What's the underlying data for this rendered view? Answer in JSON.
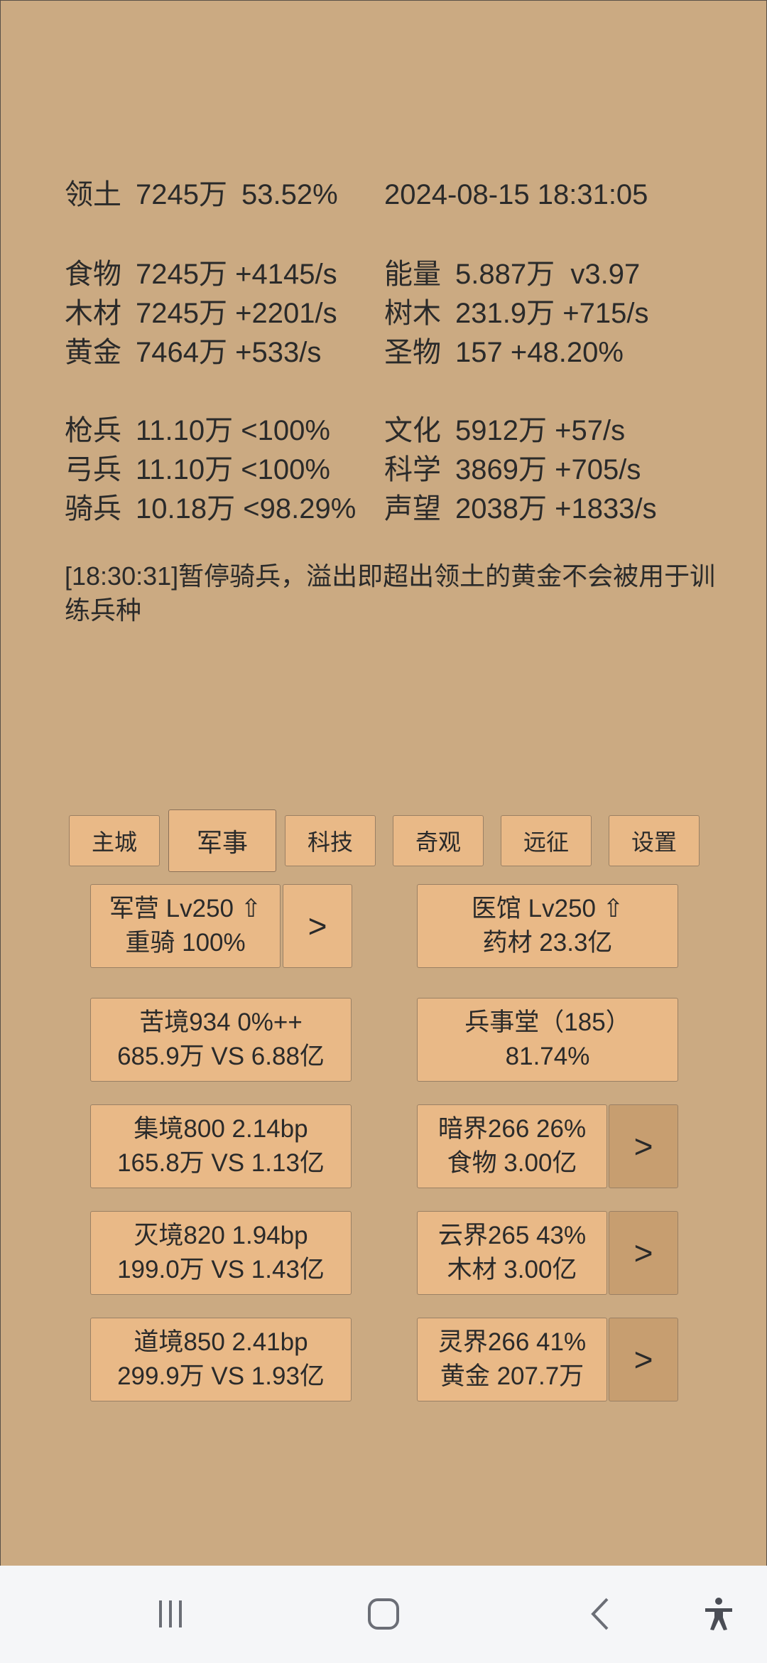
{
  "header": {
    "territory_label": "领土",
    "territory_value": "7245万",
    "territory_pct": "53.52%",
    "datetime": "2024-08-15 18:31:05"
  },
  "resources": [
    {
      "label": "食物",
      "value": "7245万",
      "rate": "+4145/s"
    },
    {
      "label": "木材",
      "value": "7245万",
      "rate": "+2201/s"
    },
    {
      "label": "黄金",
      "value": "7464万",
      "rate": "+533/s"
    }
  ],
  "resources_right": [
    {
      "label": "能量",
      "value": "5.887万",
      "rate": "v3.97"
    },
    {
      "label": "树木",
      "value": "231.9万",
      "rate": "+715/s"
    },
    {
      "label": "圣物",
      "value": "157",
      "rate": "+48.20%"
    }
  ],
  "troops": [
    {
      "label": "枪兵",
      "value": "11.10万",
      "rate": "<100%"
    },
    {
      "label": "弓兵",
      "value": "11.10万",
      "rate": "<100%"
    },
    {
      "label": "骑兵",
      "value": "10.18万",
      "rate": "<98.29%"
    }
  ],
  "stats": [
    {
      "label": "文化",
      "value": "5912万",
      "rate": "+57/s"
    },
    {
      "label": "科学",
      "value": "3869万",
      "rate": "+705/s"
    },
    {
      "label": "声望",
      "value": "2038万",
      "rate": "+1833/s"
    }
  ],
  "log_message": "[18:30:31]暂停骑兵，溢出即超出领土的黄金不会被用于训练兵种",
  "tabs": [
    "主城",
    "军事",
    "科技",
    "奇观",
    "远征",
    "设置"
  ],
  "active_tab": "军事",
  "cards": {
    "barracks": {
      "line1": "军营 Lv250 ⇧",
      "line2": "重骑 100%"
    },
    "hospital": {
      "line1": "医馆 Lv250 ⇧",
      "line2": "药材 23.3亿"
    },
    "hardship": {
      "line1": "苦境934  0%++",
      "line2": "685.9万 VS 6.88亿"
    },
    "military_hall": {
      "line1": "兵事堂（185）",
      "line2": "81.74%"
    },
    "gather": {
      "line1": "集境800  2.14bp",
      "line2": "165.8万 VS 1.13亿"
    },
    "dark_realm": {
      "line1": "暗界266  26%",
      "line2": "食物 3.00亿"
    },
    "destroy": {
      "line1": "灭境820  1.94bp",
      "line2": "199.0万 VS 1.43亿"
    },
    "cloud_realm": {
      "line1": "云界265  43%",
      "line2": "木材 3.00亿"
    },
    "dao": {
      "line1": "道境850  2.41bp",
      "line2": "299.9万 VS 1.93亿"
    },
    "spirit_realm": {
      "line1": "灵界266  41%",
      "line2": "黄金 207.7万"
    }
  },
  "arrow_label": ">",
  "navbar": {
    "recents_icon": "recents-icon",
    "home_icon": "home-icon",
    "back_icon": "back-icon",
    "accessibility_icon": "accessibility-icon"
  },
  "colors": {
    "background": "#cbaa82",
    "button": "#e9b987",
    "button_dark": "#c79e70"
  }
}
